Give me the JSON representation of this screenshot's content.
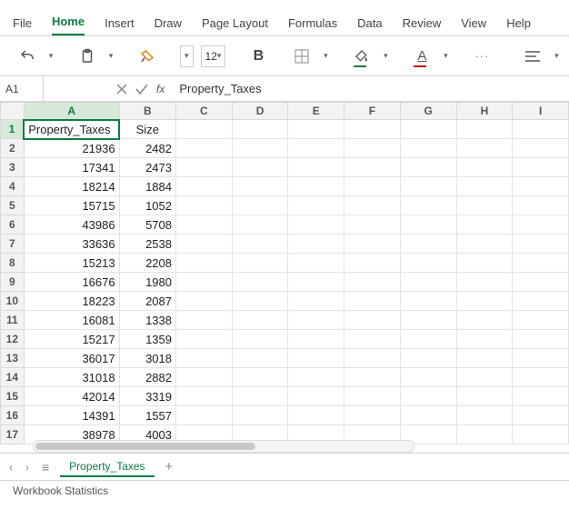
{
  "tabs": {
    "file": "File",
    "home": "Home",
    "insert": "Insert",
    "draw": "Draw",
    "page_layout": "Page Layout",
    "formulas": "Formulas",
    "data": "Data",
    "review": "Review",
    "view": "View",
    "help": "Help"
  },
  "ribbon": {
    "font_size": "12",
    "bold": "B"
  },
  "namebox": "A1",
  "fx_label": "fx",
  "formula_value": "Property_Taxes",
  "columns": [
    "A",
    "B",
    "C",
    "D",
    "E",
    "F",
    "G",
    "H",
    "I"
  ],
  "rows": [
    {
      "n": "1",
      "a": "Property_Taxes",
      "b": "Size"
    },
    {
      "n": "2",
      "a": "21936",
      "b": "2482"
    },
    {
      "n": "3",
      "a": "17341",
      "b": "2473"
    },
    {
      "n": "4",
      "a": "18214",
      "b": "1884"
    },
    {
      "n": "5",
      "a": "15715",
      "b": "1052"
    },
    {
      "n": "6",
      "a": "43986",
      "b": "5708"
    },
    {
      "n": "7",
      "a": "33636",
      "b": "2538"
    },
    {
      "n": "8",
      "a": "15213",
      "b": "2208"
    },
    {
      "n": "9",
      "a": "16676",
      "b": "1980"
    },
    {
      "n": "10",
      "a": "18223",
      "b": "2087"
    },
    {
      "n": "11",
      "a": "16081",
      "b": "1338"
    },
    {
      "n": "12",
      "a": "15217",
      "b": "1359"
    },
    {
      "n": "13",
      "a": "36017",
      "b": "3018"
    },
    {
      "n": "14",
      "a": "31018",
      "b": "2882"
    },
    {
      "n": "15",
      "a": "42014",
      "b": "3319"
    },
    {
      "n": "16",
      "a": "14391",
      "b": "1557"
    },
    {
      "n": "17",
      "a": "38978",
      "b": "4003"
    }
  ],
  "sheet_tab": "Property_Taxes",
  "add_sheet": "+",
  "statusbar": "Workbook Statistics",
  "nav_prev": "‹",
  "nav_next": "›",
  "hamburger": "≡",
  "more": "···"
}
